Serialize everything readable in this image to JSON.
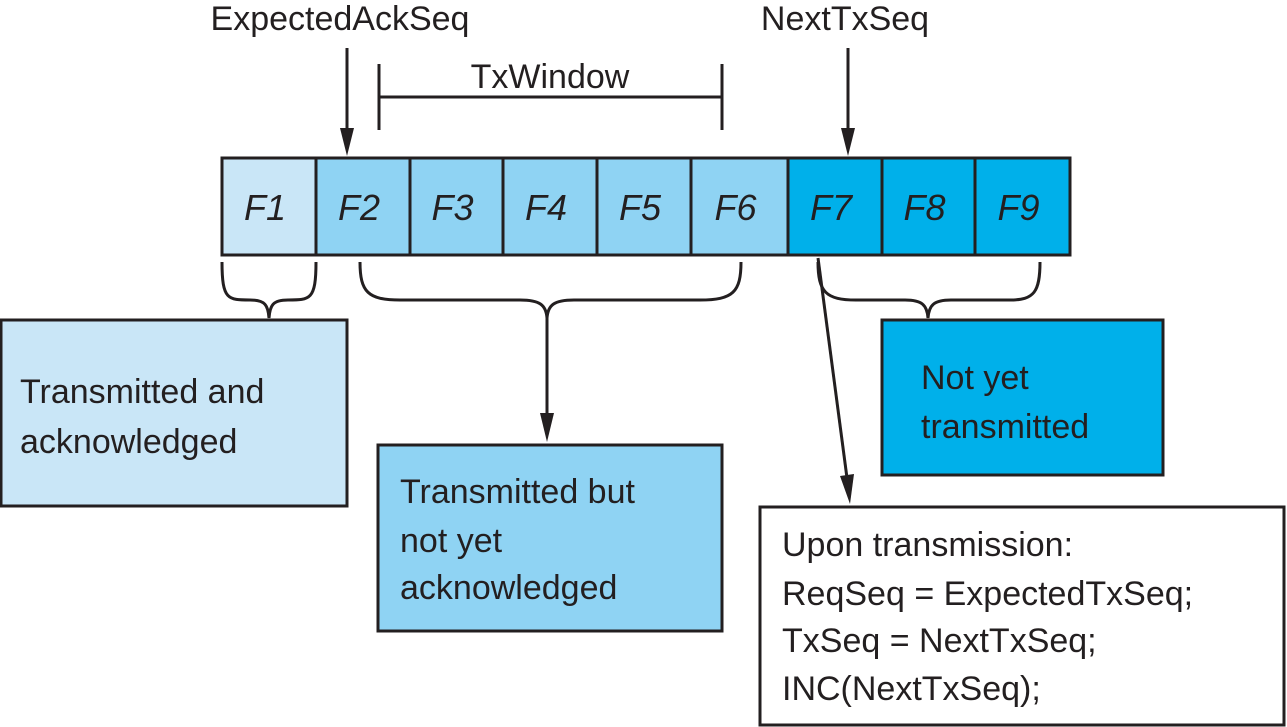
{
  "labels": {
    "expected_ack_seq": "ExpectedAckSeq",
    "next_tx_seq": "NextTxSeq",
    "tx_window": "TxWindow"
  },
  "frames": [
    {
      "label": "F1",
      "state": "acknowledged"
    },
    {
      "label": "F2",
      "state": "unacknowledged"
    },
    {
      "label": "F3",
      "state": "unacknowledged"
    },
    {
      "label": "F4",
      "state": "unacknowledged"
    },
    {
      "label": "F5",
      "state": "unacknowledged"
    },
    {
      "label": "F6",
      "state": "unacknowledged"
    },
    {
      "label": "F7",
      "state": "not-transmitted"
    },
    {
      "label": "F8",
      "state": "not-transmitted"
    },
    {
      "label": "F9",
      "state": "not-transmitted"
    }
  ],
  "colors": {
    "acknowledged": "#c9e6f7",
    "unacknowledged": "#8fd3f3",
    "not-transmitted": "#00b0ea"
  },
  "legend_boxes": {
    "acknowledged": [
      "Transmitted and",
      "acknowledged"
    ],
    "unacknowledged": [
      "Transmitted but",
      "not yet",
      "acknowledged"
    ],
    "not_transmitted": [
      "Not yet",
      "transmitted"
    ]
  },
  "note": [
    "Upon transmission:",
    "ReqSeq = ExpectedTxSeq;",
    "TxSeq = NextTxSeq;",
    "INC(NextTxSeq);"
  ]
}
